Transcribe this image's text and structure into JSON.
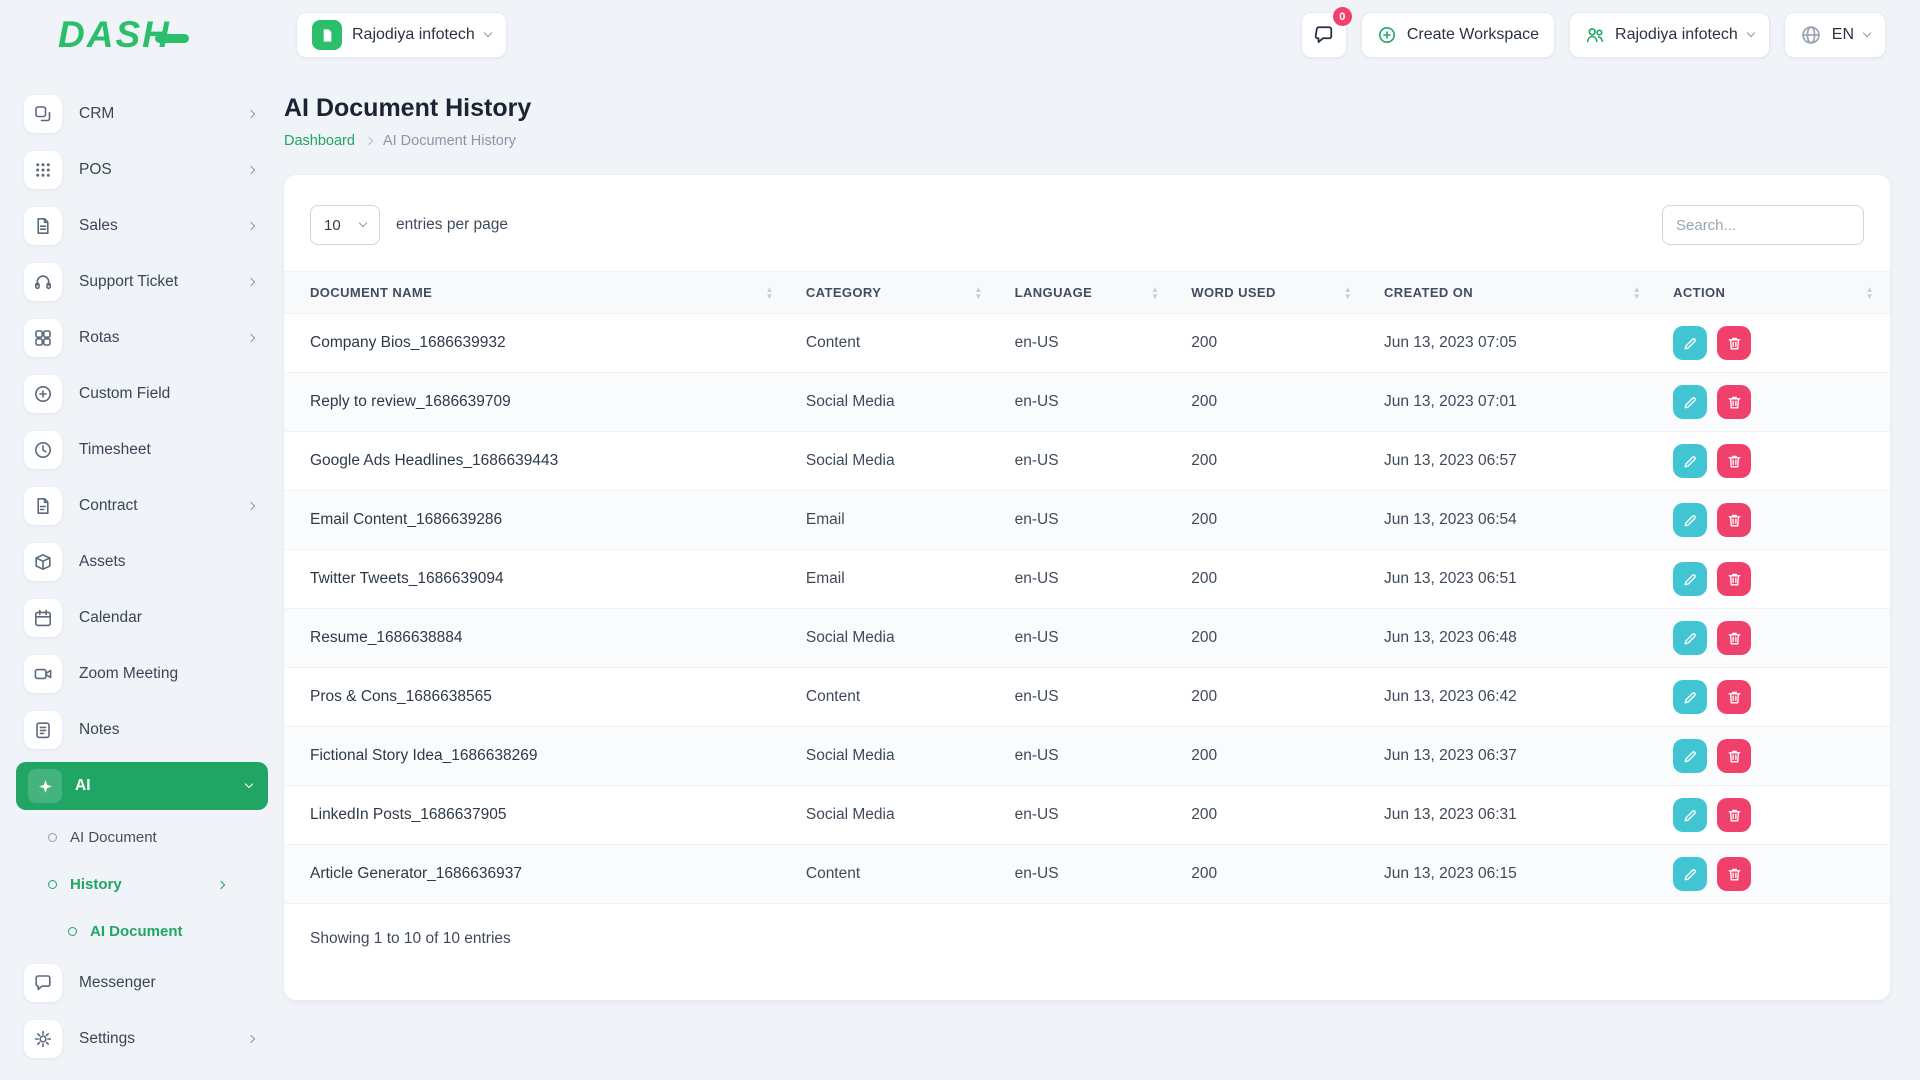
{
  "brand": {
    "logo_text": "DASH"
  },
  "header": {
    "workspace_pill": "Rajodiya infotech",
    "chat_badge": "0",
    "create_workspace": "Create Workspace",
    "account": "Rajodiya infotech",
    "language": "EN"
  },
  "sidebar": {
    "items": [
      {
        "label": "CRM",
        "icon": "crm",
        "chevron": "right"
      },
      {
        "label": "POS",
        "icon": "pos",
        "chevron": "right"
      },
      {
        "label": "Sales",
        "icon": "sales",
        "chevron": "right"
      },
      {
        "label": "Support Ticket",
        "icon": "support",
        "chevron": "right"
      },
      {
        "label": "Rotas",
        "icon": "rotas",
        "chevron": "right"
      },
      {
        "label": "Custom Field",
        "icon": "plus_circle"
      },
      {
        "label": "Timesheet",
        "icon": "clock"
      },
      {
        "label": "Contract",
        "icon": "contract",
        "chevron": "right"
      },
      {
        "label": "Assets",
        "icon": "assets"
      },
      {
        "label": "Calendar",
        "icon": "calendar"
      },
      {
        "label": "Zoom Meeting",
        "icon": "zoom"
      },
      {
        "label": "Notes",
        "icon": "notes"
      },
      {
        "label": "AI",
        "icon": "ai",
        "chevron": "down",
        "active": true,
        "submenu": [
          {
            "label": "AI Document",
            "level": 1
          },
          {
            "label": "History",
            "level": 1,
            "active": true,
            "chevron": "right"
          },
          {
            "label": "AI Document",
            "level": 2,
            "active": true
          }
        ]
      },
      {
        "label": "Messenger",
        "icon": "messenger"
      },
      {
        "label": "Settings",
        "icon": "settings",
        "chevron": "right"
      }
    ]
  },
  "page": {
    "title": "AI Document History",
    "breadcrumb_home": "Dashboard",
    "breadcrumb_current": "AI Document History"
  },
  "controls": {
    "page_size": "10",
    "entries_label": "entries per page",
    "search_placeholder": "Search..."
  },
  "table": {
    "columns": [
      "DOCUMENT NAME",
      "CATEGORY",
      "LANGUAGE",
      "WORD USED",
      "CREATED ON",
      "ACTION"
    ],
    "rows": [
      {
        "name": "Company Bios_1686639932",
        "category": "Content",
        "language": "en-US",
        "words": "200",
        "created": "Jun 13, 2023 07:05"
      },
      {
        "name": "Reply to review_1686639709",
        "category": "Social Media",
        "language": "en-US",
        "words": "200",
        "created": "Jun 13, 2023 07:01"
      },
      {
        "name": "Google Ads Headlines_1686639443",
        "category": "Social Media",
        "language": "en-US",
        "words": "200",
        "created": "Jun 13, 2023 06:57"
      },
      {
        "name": "Email Content_1686639286",
        "category": "Email",
        "language": "en-US",
        "words": "200",
        "created": "Jun 13, 2023 06:54"
      },
      {
        "name": "Twitter Tweets_1686639094",
        "category": "Email",
        "language": "en-US",
        "words": "200",
        "created": "Jun 13, 2023 06:51"
      },
      {
        "name": "Resume_1686638884",
        "category": "Social Media",
        "language": "en-US",
        "words": "200",
        "created": "Jun 13, 2023 06:48"
      },
      {
        "name": "Pros & Cons_1686638565",
        "category": "Content",
        "language": "en-US",
        "words": "200",
        "created": "Jun 13, 2023 06:42"
      },
      {
        "name": "Fictional Story Idea_1686638269",
        "category": "Social Media",
        "language": "en-US",
        "words": "200",
        "created": "Jun 13, 2023 06:37"
      },
      {
        "name": "LinkedIn Posts_1686637905",
        "category": "Social Media",
        "language": "en-US",
        "words": "200",
        "created": "Jun 13, 2023 06:31"
      },
      {
        "name": "Article Generator_1686636937",
        "category": "Content",
        "language": "en-US",
        "words": "200",
        "created": "Jun 13, 2023 06:15"
      }
    ],
    "footer": "Showing 1 to 10 of 10 entries"
  },
  "colors": {
    "accent_green": "#21a565",
    "logo_green": "#2bbf6c",
    "edit_cyan": "#41c5d3",
    "delete_pink": "#f0416c"
  }
}
